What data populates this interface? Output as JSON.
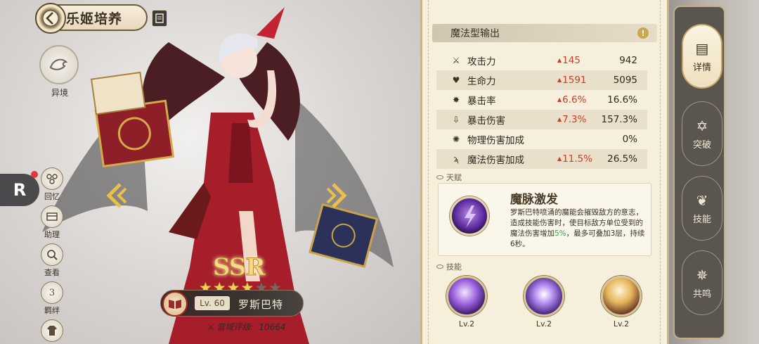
{
  "header": {
    "title": "乐姬培养"
  },
  "realm": {
    "label": "异境"
  },
  "side_menu": [
    {
      "label": "回忆",
      "icon": "memory-icon"
    },
    {
      "label": "助理",
      "icon": "assistant-icon"
    },
    {
      "label": "查看",
      "icon": "view-icon"
    },
    {
      "label": "羁绊",
      "icon": "bond-icon",
      "badge": "3"
    },
    {
      "label": "衣橱",
      "icon": "wardrobe-icon"
    }
  ],
  "character": {
    "rarity": "SSR",
    "stars_total": 6,
    "stars_filled": 4,
    "level": "Lv. 60",
    "name": "罗斯巴特",
    "rating_label": "音域评级:",
    "rating_value": "10664"
  },
  "stats": {
    "header": "魔法型输出",
    "rows": [
      {
        "name": "攻击力",
        "icon": "sword-icon",
        "increase": "145",
        "value": "942"
      },
      {
        "name": "生命力",
        "icon": "heart-icon",
        "increase": "1591",
        "value": "5095"
      },
      {
        "name": "暴击率",
        "icon": "crit-icon",
        "increase": "6.6%",
        "value": "16.6%"
      },
      {
        "name": "暴击伤害",
        "icon": "crit-damage-icon",
        "increase": "7.3%",
        "value": "157.3%"
      },
      {
        "name": "物理伤害加成",
        "icon": "gear-icon",
        "increase": "",
        "value": "0%"
      },
      {
        "name": "魔法伤害加成",
        "icon": "magic-icon",
        "increase": "11.5%",
        "value": "26.5%"
      }
    ]
  },
  "talent": {
    "section_label": "天赋",
    "name": "魔脉激发",
    "desc_before": "罗斯巴特喷涌的魔能会摧毁敌方的意志，造成技能伤害时，使目标敌方单位受到的魔法伤害增加",
    "desc_highlight": "5%",
    "desc_after": "，最多可叠加3层，持续6秒。"
  },
  "skills": {
    "section_label": "技能",
    "items": [
      {
        "level": "Lv.2"
      },
      {
        "level": "Lv.2"
      },
      {
        "level": "Lv.2"
      }
    ]
  },
  "tabs": [
    {
      "label": "详情",
      "icon": "scroll-icon",
      "active": true
    },
    {
      "label": "突破",
      "icon": "breakthrough-icon",
      "active": false
    },
    {
      "label": "技能",
      "icon": "skill-icon",
      "active": false
    },
    {
      "label": "共鸣",
      "icon": "resonance-icon",
      "active": false
    }
  ],
  "colors": {
    "increase": "#c8402a",
    "highlight": "#3aa34c",
    "star_on": "#f3cf56"
  }
}
